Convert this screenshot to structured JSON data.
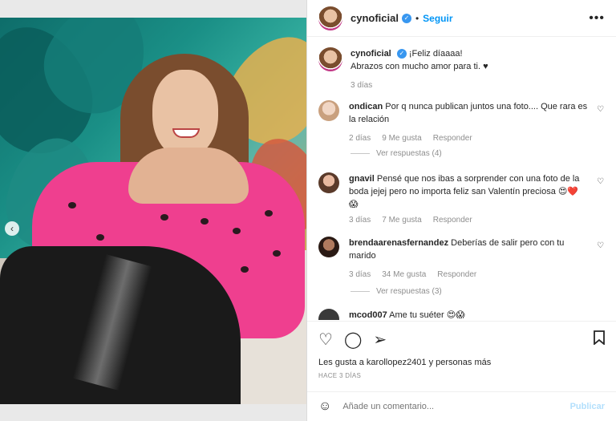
{
  "post": {
    "username": "cynoficial",
    "follow_label": "Seguir",
    "more_label": "•••",
    "caption_line1": "¡Feliz díaaaa!",
    "caption_line2": "Abrazos con mucho amor para ti. ♥",
    "caption_time": "3 días"
  },
  "comments": [
    {
      "user": "ondican",
      "text": "Por q nunca publican juntos una foto.... Que rara es la relación",
      "time": "2 días",
      "likes": "9 Me gusta",
      "reply": "Responder",
      "view_replies": "Ver respuestas (4)"
    },
    {
      "user": "gnavil",
      "text": "Pensé que nos ibas a sorprender con una foto de la boda jejej pero no importa feliz san Valentín preciosa 😍❤️ 😱",
      "time": "3 días",
      "likes": "7 Me gusta",
      "reply": "Responder"
    },
    {
      "user": "brendaarenasfernandez",
      "text": "Deberías de salir pero con tu marido",
      "time": "3 días",
      "likes": "34 Me gusta",
      "reply": "Responder",
      "view_replies": "Ver respuestas (3)"
    },
    {
      "user": "mcod007",
      "text": "Ame tu suéter 😍😱"
    }
  ],
  "actions": {
    "likes_text": "Les gusta a karollopez2401 y personas más",
    "time_upper": "HACE 3 DÍAS"
  },
  "composer": {
    "placeholder": "Añade un comentario...",
    "publish_label": "Publicar"
  },
  "icons": {
    "heart": "heart-icon",
    "comment": "comment-icon",
    "share": "share-icon",
    "bookmark": "bookmark-icon",
    "emoji": "emoji-icon",
    "verified": "verified-icon",
    "chevron": "chevron-left-icon"
  },
  "colors": {
    "accent": "#0095f6",
    "verified": "#3897f0",
    "muted": "#8e8e8e",
    "publish_disabled": "#b2dffc"
  }
}
